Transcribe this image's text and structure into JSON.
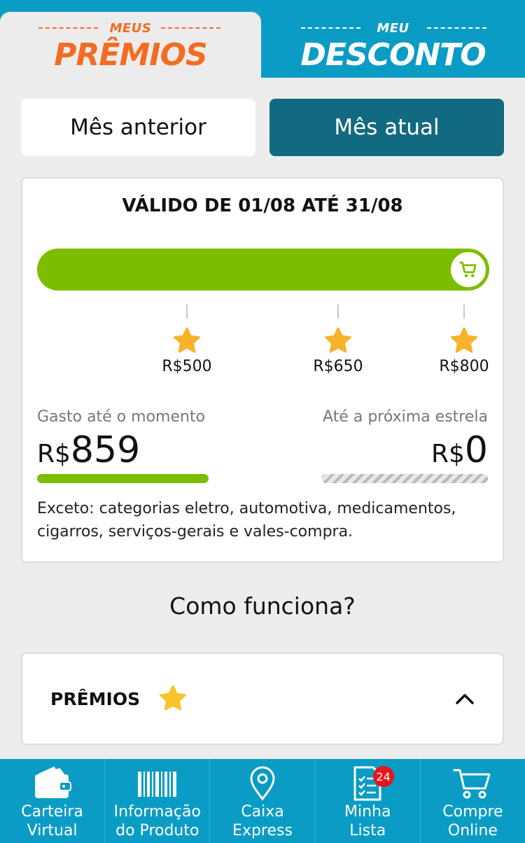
{
  "header": {
    "tab_premios": {
      "small": "MEUS",
      "big": "PRÊMIOS"
    },
    "tab_desconto": {
      "small": "MEU",
      "big": "DESCONTO"
    },
    "colors": {
      "brand_blue": "#0a9cc5",
      "orange": "#f36c21"
    }
  },
  "month_toggle": {
    "previous_label": "Mês anterior",
    "current_label": "Mês atual"
  },
  "card": {
    "validity": "VÁLIDO DE 01/08 ATÉ 31/08",
    "progress_fraction": 1.0,
    "milestones": [
      {
        "label": "R$500",
        "icon": "star-icon"
      },
      {
        "label": "R$650",
        "icon": "star-icon"
      },
      {
        "label": "R$800",
        "icon": "star-icon"
      }
    ],
    "spent_label": "Gasto até o momento",
    "spent_currency": "R$",
    "spent_value": "859",
    "next_label": "Até a próxima estrela",
    "next_currency": "R$",
    "next_value": "0",
    "exception_text": "Exceto: categorias eletro, automotiva, medicamentos, cigarros, serviços-gerais e vales-compra.",
    "accent_green": "#7dbd00"
  },
  "how_it_works": "Como funciona?",
  "accordion": {
    "title": "PRÊMIOS",
    "icon": "star-icon",
    "state": "expanded"
  },
  "bottom_nav": [
    {
      "line1": "Carteira",
      "line2": "Virtual",
      "icon": "wallet-icon"
    },
    {
      "line1": "Informação",
      "line2": "do Produto",
      "icon": "barcode-icon"
    },
    {
      "line1": "Caixa",
      "line2": "Express",
      "icon": "location-pin-icon"
    },
    {
      "line1": "Minha",
      "line2": "Lista",
      "icon": "checklist-icon",
      "badge": "24"
    },
    {
      "line1": "Compre",
      "line2": "Online",
      "icon": "cart-icon"
    }
  ]
}
